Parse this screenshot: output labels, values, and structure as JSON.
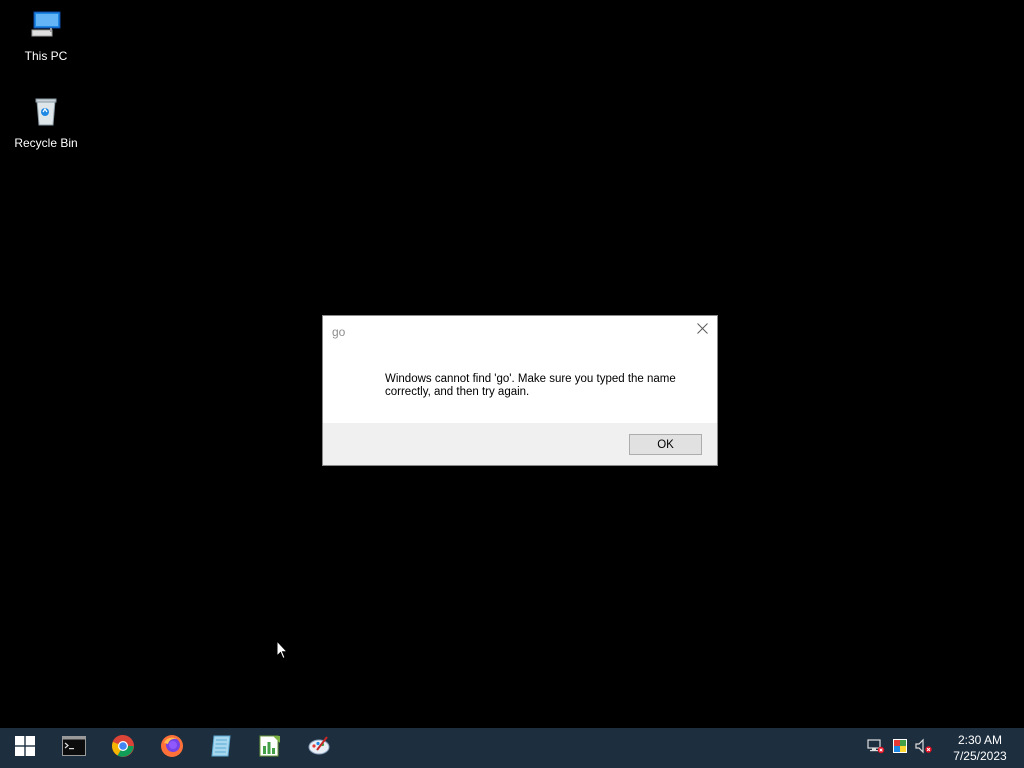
{
  "desktop": {
    "icons": [
      {
        "label": "This PC",
        "icon": "this-pc-icon"
      },
      {
        "label": "Recycle Bin",
        "icon": "recycle-bin-icon"
      }
    ]
  },
  "dialog": {
    "title": "go",
    "message": "Windows cannot find 'go'. Make sure you typed the name correctly, and then try again.",
    "ok_label": "OK",
    "close_icon": "close-icon"
  },
  "taskbar": {
    "apps": [
      {
        "name": "start-button",
        "icon": "windows-logo-icon"
      },
      {
        "name": "command-prompt",
        "icon": "terminal-icon"
      },
      {
        "name": "google-chrome",
        "icon": "chrome-icon"
      },
      {
        "name": "firefox",
        "icon": "firefox-icon"
      },
      {
        "name": "notepad",
        "icon": "notepad-icon"
      },
      {
        "name": "spreadsheet-editor",
        "icon": "spreadsheet-icon"
      },
      {
        "name": "paint",
        "icon": "paint-icon"
      }
    ],
    "tray": {
      "icons": [
        "network-disconnected-icon",
        "display-icon",
        "volume-muted-icon"
      ],
      "time": "2:30 AM",
      "date": "7/25/2023"
    }
  },
  "colors": {
    "desktop_bg": "#000000",
    "taskbar_bg": "#1d2e3f",
    "dialog_footer_bg": "#f0f0f0",
    "button_bg": "#e1e1e1"
  }
}
